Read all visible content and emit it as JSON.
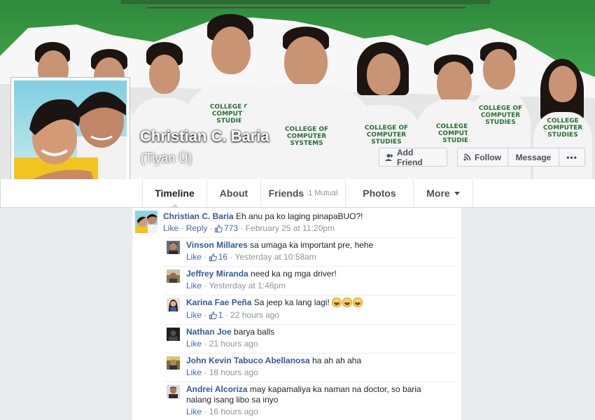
{
  "profile": {
    "name": "Christian C. Baria",
    "alternate_name": "(Tiyan Ü)"
  },
  "cover": {
    "shirt_text": "COLLEGE OF COMPUTER STUDIES"
  },
  "actions": {
    "add_friend": "Add Friend",
    "follow": "Follow",
    "message": "Message",
    "more_dots": "•••"
  },
  "nav": {
    "timeline": "Timeline",
    "about": "About",
    "friends": "Friends",
    "friends_sub": "1 Mutual",
    "photos": "Photos",
    "more": "More"
  },
  "main_comment": {
    "author": "Christian C. Baria",
    "text": "Eh anu pa ko laging pinapaBUO?!",
    "like": "Like",
    "reply": "Reply",
    "likes": "773",
    "time": "February 25 at 11:20pm"
  },
  "replies": [
    {
      "author": "Vinson Millares",
      "text": "sa umaga ka important pre, hehe",
      "like": "Like",
      "likes": "16",
      "time": "Yesterday at 10:58am"
    },
    {
      "author": "Jeffrey Miranda",
      "text": "need ka ng mga driver!",
      "like": "Like",
      "likes": "",
      "time": "Yesterday at 1:46pm"
    },
    {
      "author": "Karina Fae Peña",
      "text": "Sa jeep ka lang lagi!",
      "like": "Like",
      "likes": "1",
      "time": "22 hours ago"
    },
    {
      "author": "Nathan Joe",
      "text": "barya balls",
      "like": "Like",
      "likes": "",
      "time": "21 hours ago"
    },
    {
      "author": "John Kevin Tabuco Abellanosa",
      "text": "ha ah ah aha",
      "like": "Like",
      "likes": "",
      "time": "18 hours ago"
    },
    {
      "author": "Andrei Alcoriza",
      "text": "may kapamaliya ka naman na doctor, so baria",
      "text2": "nalang isang libo sa inyo",
      "like": "Like",
      "likes": "",
      "time": "16 hours ago"
    }
  ],
  "colors": {
    "link": "#365899",
    "meta": "#90949c",
    "cover_green": "#3fa34b"
  }
}
